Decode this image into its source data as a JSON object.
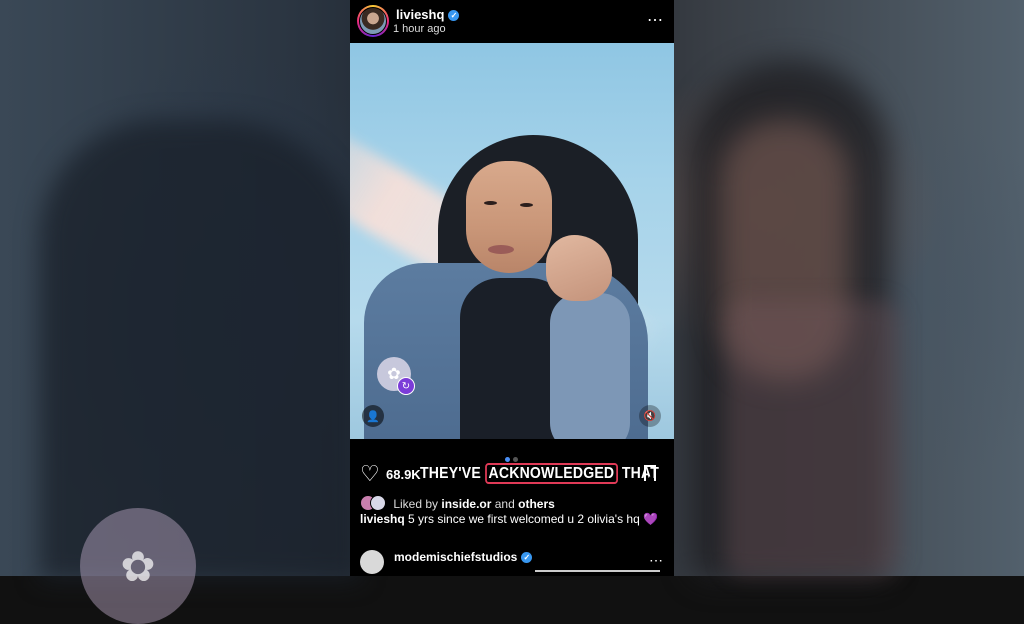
{
  "post": {
    "username": "livieshq",
    "time": "1 hour ago",
    "more_icon": "⋯",
    "likes": "68.9K",
    "caption_overlay": {
      "before": "THEY'VE",
      "highlight": "ACKNOWLEDGED",
      "after": "THAT"
    },
    "liked_by": {
      "prefix": "Liked by",
      "user": "inside.or",
      "middle": "and",
      "others": "others"
    },
    "caption": {
      "user": "livieshq",
      "text": "5 yrs since we first welcomed u 2 olivia's hq",
      "emoji": "💜"
    },
    "carousel": {
      "count": 2,
      "active": 1
    }
  },
  "comment": {
    "username": "modemischiefstudios",
    "more_icon": "⋯"
  },
  "icons": {
    "verified": "verified-badge-icon",
    "heart": "heart-icon",
    "bookmark": "bookmark-icon",
    "remix": "remix-icon",
    "tag": "person-tag-icon",
    "mute": "speaker-mute-icon"
  },
  "colors": {
    "verified": "#3897f0",
    "highlight_border": "#e03a57",
    "carousel_active": "#4a8ef5",
    "remix_badge": "#7b3cd8"
  }
}
